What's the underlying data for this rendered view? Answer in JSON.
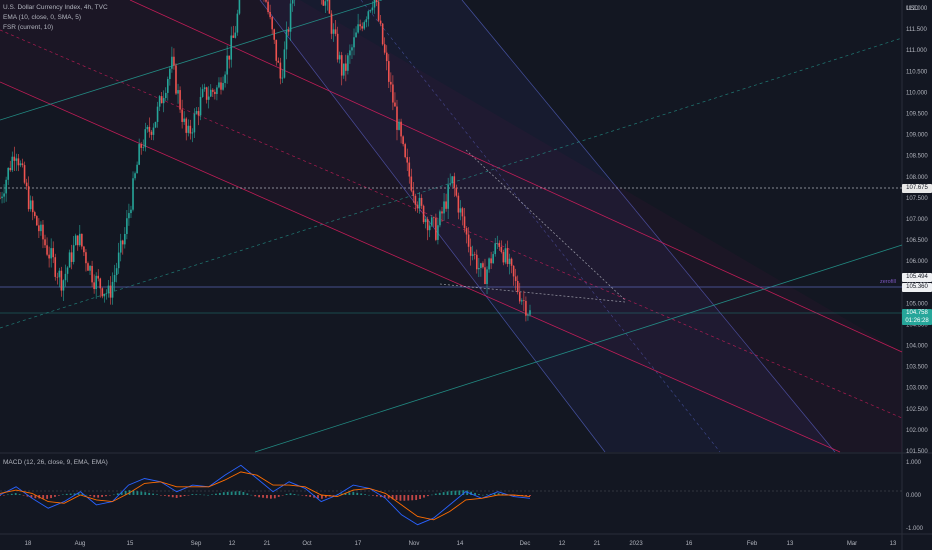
{
  "legend": {
    "symbol_line": "U.S. Dollar Currency Index, 4h, TVC",
    "ema_line": "EMA (10, close, 0, SMA, 5)",
    "fsr_line": "FSR (current, 10)",
    "macd_line": "MACD (12, 26, close, 9, EMA, EMA)"
  },
  "price_tags": {
    "level_high": "107.675",
    "level_a": "105.494",
    "level_b": "105.360",
    "current_price": "104.758",
    "countdown": "01:26:28",
    "annotation": "zerofill"
  },
  "colors": {
    "background": "#131722",
    "up_candle": "#26a69a",
    "down_candle": "#ef5350",
    "teal_channel": "#26a69a",
    "red_channel": "#e91e63",
    "blue_channel": "#5b6bd6",
    "macd_line": "#2962ff",
    "signal_line": "#ff6d00"
  },
  "chart_data": [
    {
      "type": "candlestick",
      "title": "U.S. Dollar Currency Index, 4h, TVC",
      "currency": "USD",
      "ylim": [
        101.5,
        112.0
      ],
      "y_ticks": [
        "112.000",
        "111.500",
        "111.000",
        "110.500",
        "110.000",
        "109.500",
        "109.000",
        "108.500",
        "108.000",
        "107.500",
        "107.000",
        "106.500",
        "106.000",
        "105.500",
        "105.000",
        "104.500",
        "104.000",
        "103.500",
        "103.000",
        "102.500",
        "102.000",
        "101.500"
      ],
      "x_ticks": [
        "18",
        "Aug",
        "15",
        "Sep",
        "12",
        "21",
        "Oct",
        "17",
        "Nov",
        "14",
        "Dec",
        "12",
        "21",
        "2023",
        "16",
        "Feb",
        "13",
        "Mar",
        "13"
      ],
      "close_path": [
        {
          "x": "18",
          "y": 107.5
        },
        {
          "x": "",
          "y": 108.7
        },
        {
          "x": "",
          "y": 107.2
        },
        {
          "x": "",
          "y": 106.3
        },
        {
          "x": "Aug",
          "y": 105.5
        },
        {
          "x": "",
          "y": 106.6
        },
        {
          "x": "",
          "y": 105.6
        },
        {
          "x": "15",
          "y": 105.2
        },
        {
          "x": "",
          "y": 106.6
        },
        {
          "x": "",
          "y": 108.7
        },
        {
          "x": "Sep",
          "y": 109.4
        },
        {
          "x": "",
          "y": 110.7
        },
        {
          "x": "",
          "y": 108.9
        },
        {
          "x": "12",
          "y": 109.9
        },
        {
          "x": "",
          "y": 110.1
        },
        {
          "x": "21",
          "y": 111.3
        },
        {
          "x": "",
          "y": 113.5
        },
        {
          "x": "Oct",
          "y": 112.3
        },
        {
          "x": "",
          "y": 110.3
        },
        {
          "x": "",
          "y": 112.8
        },
        {
          "x": "17",
          "y": 113.0
        },
        {
          "x": "",
          "y": 112.0
        },
        {
          "x": "",
          "y": 110.4
        },
        {
          "x": "Nov",
          "y": 111.5
        },
        {
          "x": "",
          "y": 112.3
        },
        {
          "x": "",
          "y": 110.2
        },
        {
          "x": "",
          "y": 108.3
        },
        {
          "x": "",
          "y": 107.2
        },
        {
          "x": "14",
          "y": 106.7
        },
        {
          "x": "",
          "y": 107.9
        },
        {
          "x": "",
          "y": 106.5
        },
        {
          "x": "",
          "y": 105.6
        },
        {
          "x": "",
          "y": 106.5
        },
        {
          "x": "",
          "y": 105.5
        },
        {
          "x": "Dec",
          "y": 104.758
        }
      ],
      "horizontal_levels": [
        107.675,
        105.494,
        105.36,
        104.758
      ]
    },
    {
      "type": "line",
      "title": "MACD (12, 26, close, 9, EMA, EMA)",
      "ylim": [
        -1.0,
        1.0
      ],
      "y_ticks": [
        "1.000",
        "0.000",
        "-1.000"
      ],
      "series": [
        {
          "values": [
            0.0,
            0.25,
            -0.1,
            -0.4,
            -0.2,
            0.1,
            -0.3,
            -0.2,
            0.3,
            0.5,
            0.4,
            0.1,
            0.3,
            0.25,
            0.6,
            0.9,
            0.5,
            0.1,
            0.4,
            0.2,
            -0.2,
            0.0,
            0.3,
            0.2,
            -0.1,
            -0.6,
            -0.9,
            -0.7,
            -0.3,
            0.1,
            -0.1,
            0.1,
            -0.05,
            -0.1
          ]
        },
        {
          "values": [
            0.05,
            0.15,
            0.05,
            -0.2,
            -0.25,
            0.0,
            -0.15,
            -0.2,
            0.05,
            0.35,
            0.4,
            0.25,
            0.25,
            0.25,
            0.45,
            0.7,
            0.6,
            0.3,
            0.3,
            0.25,
            0.0,
            -0.05,
            0.15,
            0.2,
            0.05,
            -0.3,
            -0.65,
            -0.75,
            -0.5,
            -0.15,
            -0.1,
            0.0,
            0.0,
            -0.05
          ]
        }
      ]
    }
  ]
}
